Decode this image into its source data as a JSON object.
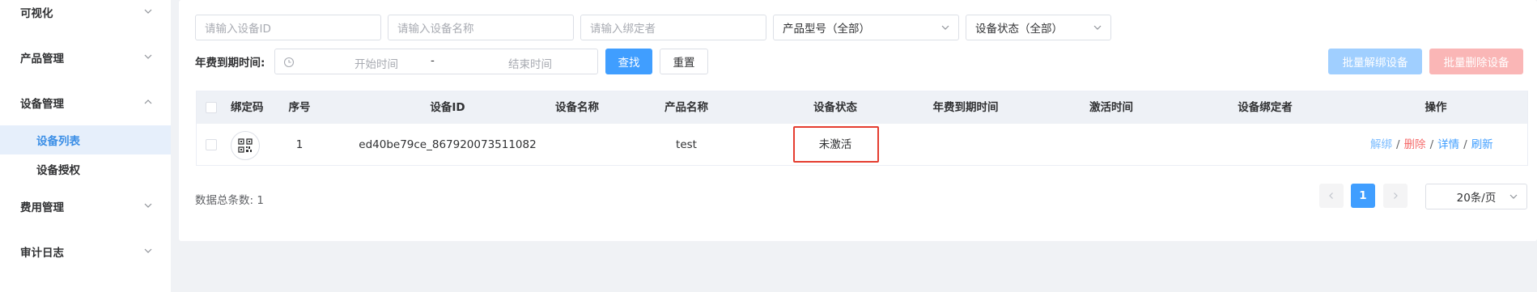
{
  "sidebar": {
    "groups": [
      {
        "label": "可视化",
        "expanded": false
      },
      {
        "label": "产品管理",
        "expanded": false
      },
      {
        "label": "设备管理",
        "expanded": true
      },
      {
        "label": "费用管理",
        "expanded": false
      },
      {
        "label": "审计日志",
        "expanded": false
      }
    ],
    "sub_items": [
      {
        "label": "设备列表",
        "active": true
      },
      {
        "label": "设备授权",
        "active": false
      }
    ]
  },
  "filters": {
    "device_id_placeholder": "请输入设备ID",
    "device_name_placeholder": "请输入设备名称",
    "binder_placeholder": "请输入绑定者",
    "product_model_value": "产品型号（全部）",
    "device_status_value": "设备状态（全部）",
    "expiry_label": "年费到期时间:",
    "start_placeholder": "开始时间",
    "range_separator": "-",
    "end_placeholder": "结束时间",
    "search_label": "查找",
    "reset_label": "重置",
    "batch_unbind_label": "批量解绑设备",
    "batch_delete_label": "批量删除设备"
  },
  "table": {
    "headers": [
      "绑定码",
      "序号",
      "设备ID",
      "设备名称",
      "产品名称",
      "设备状态",
      "年费到期时间",
      "激活时间",
      "设备绑定者",
      "操作"
    ],
    "rows": [
      {
        "index": "1",
        "device_id": "ed40be79ce_867920073511082",
        "device_name": "",
        "product_name": "test",
        "status": "未激活",
        "expiry": "",
        "activated": "",
        "binder": "",
        "actions": {
          "unbind": "解绑",
          "delete": "删除",
          "detail": "详情",
          "refresh": "刷新",
          "separator": "/"
        }
      }
    ]
  },
  "footer": {
    "total_text": "数据总条数: 1",
    "current_page": "1",
    "page_size": "20条/页"
  },
  "colors": {
    "primary": "#409eff",
    "danger": "#f56c6c",
    "highlight_border": "#e53d30",
    "active_menu_bg": "#e6effb"
  }
}
